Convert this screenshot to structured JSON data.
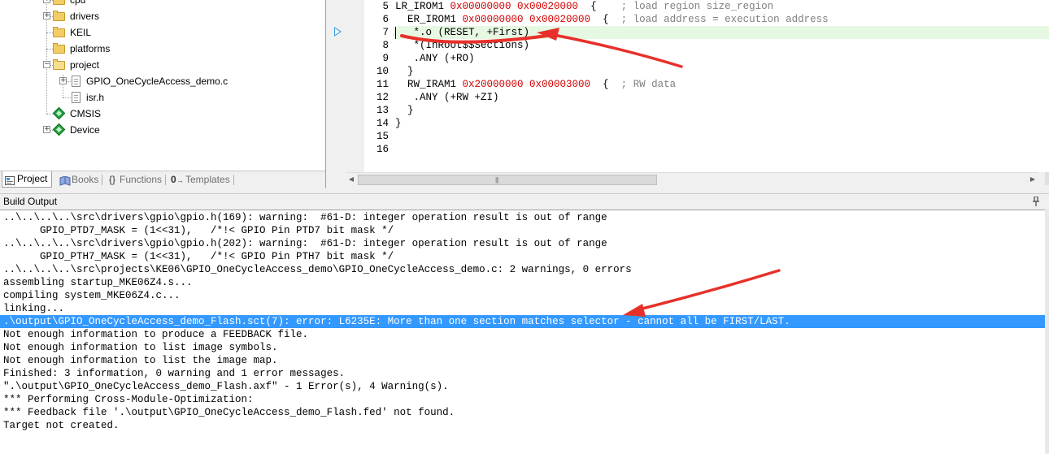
{
  "project_tree": {
    "items": [
      {
        "label": "cpu",
        "icon": "folder-icon",
        "expander": "+"
      },
      {
        "label": "drivers",
        "icon": "folder-icon",
        "expander": "+"
      },
      {
        "label": "KEIL",
        "icon": "folder-icon",
        "expander": ""
      },
      {
        "label": "platforms",
        "icon": "folder-icon",
        "expander": ""
      },
      {
        "label": "project",
        "icon": "folder-open-icon",
        "expander": "−"
      },
      {
        "label": "GPIO_OneCycleAccess_demo.c",
        "icon": "file-icon",
        "expander": "+"
      },
      {
        "label": "isr.h",
        "icon": "file-icon",
        "expander": ""
      },
      {
        "label": "CMSIS",
        "icon": "gem-icon",
        "expander": ""
      },
      {
        "label": "Device",
        "icon": "gem-icon",
        "expander": "+"
      }
    ]
  },
  "panel_tabs": [
    {
      "label": "Project",
      "active": true
    },
    {
      "label": "Books",
      "active": false
    },
    {
      "label": "Functions",
      "active": false,
      "prefix": "{}"
    },
    {
      "label": "Templates",
      "active": false,
      "prefix": "0"
    }
  ],
  "editor": {
    "lines": [
      {
        "no": "5",
        "segs": [
          [
            "",
            "LR_IROM1 "
          ],
          [
            "num",
            "0x00000000"
          ],
          [
            "",
            " "
          ],
          [
            "num",
            "0x00020000"
          ],
          [
            "",
            "  {    "
          ],
          [
            "cmt",
            "; load region size_region"
          ]
        ]
      },
      {
        "no": "6",
        "segs": [
          [
            "",
            "  ER_IROM1 "
          ],
          [
            "num",
            "0x00000000"
          ],
          [
            "",
            " "
          ],
          [
            "num",
            "0x00020000"
          ],
          [
            "",
            "  {  "
          ],
          [
            "cmt",
            "; load address = execution address"
          ]
        ]
      },
      {
        "no": "7",
        "segs": [
          [
            "",
            "   *.o (RESET, +First)"
          ]
        ]
      },
      {
        "no": "8",
        "segs": [
          [
            "",
            "   *(InRoot$$Sections)"
          ]
        ]
      },
      {
        "no": "9",
        "segs": [
          [
            "",
            "   .ANY (+RO)"
          ]
        ]
      },
      {
        "no": "10",
        "segs": [
          [
            "",
            "  }"
          ]
        ]
      },
      {
        "no": "11",
        "segs": [
          [
            "",
            "  RW_IRAM1 "
          ],
          [
            "num",
            "0x20000000"
          ],
          [
            "",
            " "
          ],
          [
            "num",
            "0x00003000"
          ],
          [
            "",
            "  {  "
          ],
          [
            "cmt",
            "; RW data"
          ]
        ]
      },
      {
        "no": "12",
        "segs": [
          [
            "",
            "   .ANY (+RW +ZI)"
          ]
        ]
      },
      {
        "no": "13",
        "segs": [
          [
            "",
            "  }"
          ]
        ]
      },
      {
        "no": "14",
        "segs": [
          [
            "",
            "}"
          ]
        ]
      },
      {
        "no": "15",
        "segs": [
          [
            "",
            ""
          ]
        ]
      },
      {
        "no": "16",
        "segs": [
          [
            "",
            ""
          ]
        ]
      }
    ]
  },
  "build_output": {
    "title": "Build Output",
    "selected_index": 8,
    "lines": [
      "..\\..\\..\\..\\src\\drivers\\gpio\\gpio.h(169): warning:  #61-D: integer operation result is out of range",
      "      GPIO_PTD7_MASK = (1<<31),   /*!< GPIO Pin PTD7 bit mask */",
      "..\\..\\..\\..\\src\\drivers\\gpio\\gpio.h(202): warning:  #61-D: integer operation result is out of range",
      "      GPIO_PTH7_MASK = (1<<31),   /*!< GPIO Pin PTH7 bit mask */",
      "..\\..\\..\\..\\src\\projects\\KE06\\GPIO_OneCycleAccess_demo\\GPIO_OneCycleAccess_demo.c: 2 warnings, 0 errors",
      "assembling startup_MKE06Z4.s...",
      "compiling system_MKE06Z4.c...",
      "linking...",
      ".\\output\\GPIO_OneCycleAccess_demo_Flash.sct(7): error: L6235E: More than one section matches selector - cannot all be FIRST/LAST.",
      "Not enough information to produce a FEEDBACK file.",
      "Not enough information to list image symbols.",
      "Not enough information to list the image map.",
      "Finished: 3 information, 0 warning and 1 error messages.",
      "\".\\output\\GPIO_OneCycleAccess_demo_Flash.axf\" - 1 Error(s), 4 Warning(s).",
      "*** Performing Cross-Module-Optimization:",
      "*** Feedback file '.\\output\\GPIO_OneCycleAccess_demo_Flash.fed' not found.",
      "Target not created."
    ]
  },
  "colors": {
    "annotation": "#e8302a",
    "selection": "#3399ff",
    "highlight_line": "#e6f8e2",
    "hex_literal": "#d00000",
    "comment": "#808080"
  }
}
